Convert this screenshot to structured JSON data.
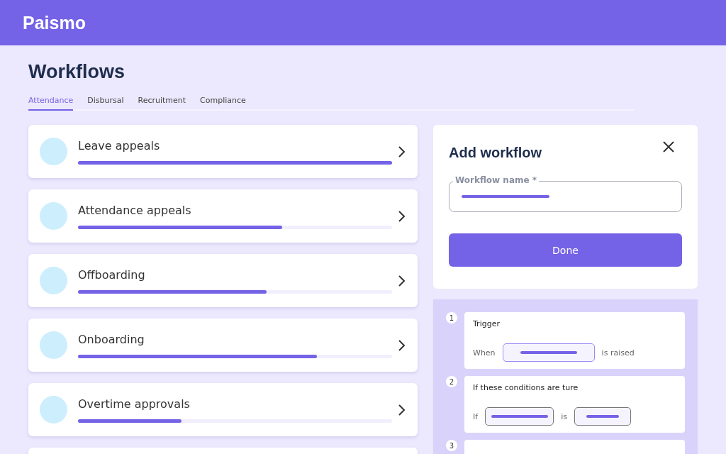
{
  "header": {
    "logo": "Paismo"
  },
  "page": {
    "title": "Workflows"
  },
  "tabs": [
    {
      "label": "Attendance",
      "selected": true
    },
    {
      "label": "Disbursal",
      "selected": false
    },
    {
      "label": "Recruitment",
      "selected": false
    },
    {
      "label": "Compliance",
      "selected": false
    }
  ],
  "workflows": [
    {
      "name": "Leave appeals",
      "level": 1.0
    },
    {
      "name": "Attendance appeals",
      "level": 0.65
    },
    {
      "name": "Offboarding",
      "level": 0.6
    },
    {
      "name": "Onboarding",
      "level": 0.76
    },
    {
      "name": "Overtime approvals",
      "level": 0.33
    }
  ],
  "dialog": {
    "title": "Add workflow",
    "field_label": "Workflow name *",
    "button": "Done"
  },
  "steps": [
    {
      "number": "1",
      "kind": "trigger",
      "title": "Trigger",
      "prefix": "When",
      "suffix": "is raised"
    },
    {
      "number": "2",
      "kind": "condition",
      "title": "If these conditions are ture",
      "prefix": "If",
      "middle": "is"
    },
    {
      "number": "3",
      "kind": "partial"
    }
  ]
}
